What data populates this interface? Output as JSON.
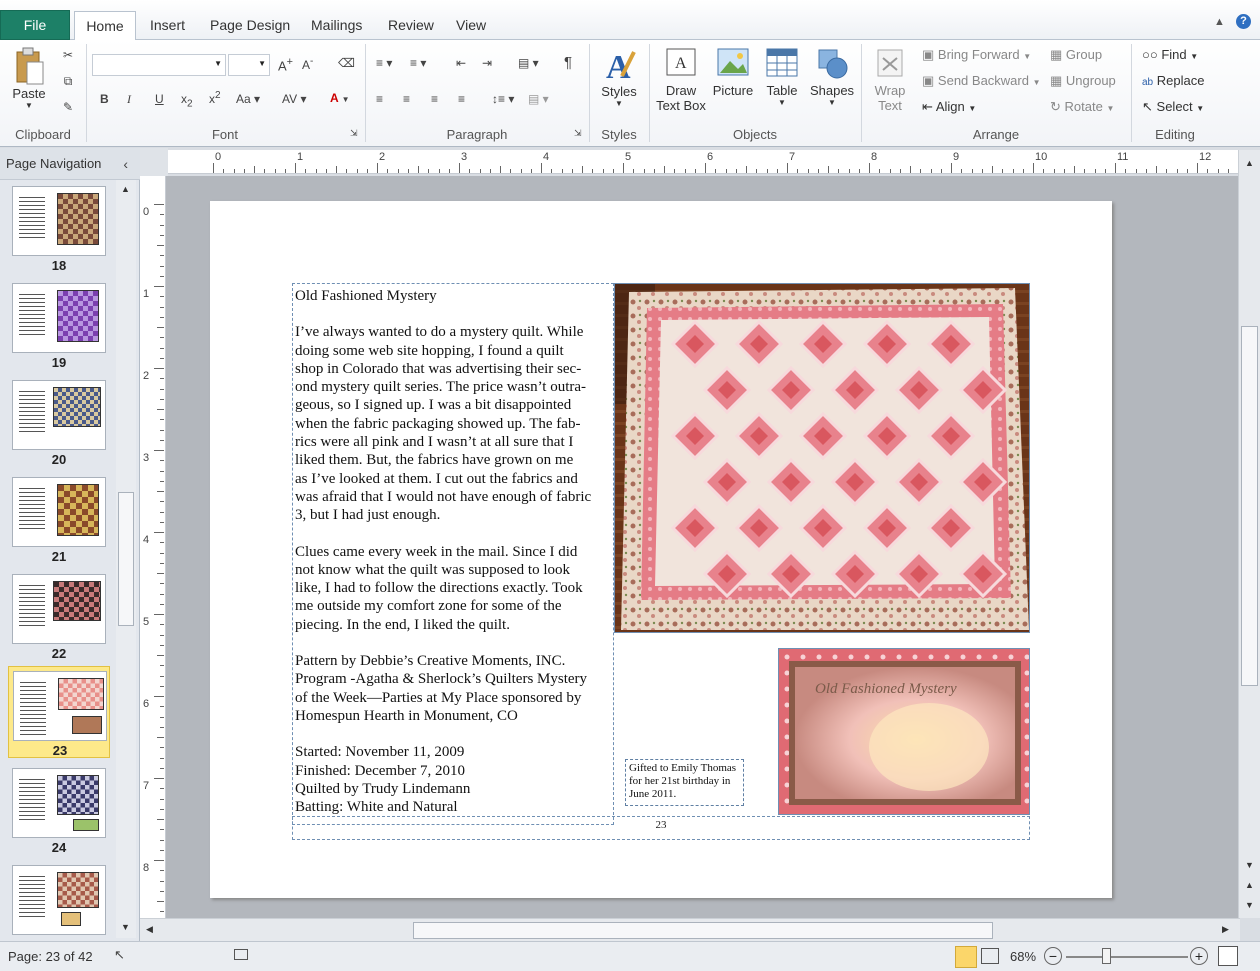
{
  "tabs": {
    "file": "File",
    "home": "Home",
    "insert": "Insert",
    "page_design": "Page Design",
    "mailings": "Mailings",
    "review": "Review",
    "view": "View"
  },
  "clipboard": {
    "paste": "Paste",
    "label": "Clipboard"
  },
  "font": {
    "label": "Font",
    "name_value": "",
    "size_value": ""
  },
  "paragraph": {
    "label": "Paragraph"
  },
  "styles": {
    "button": "Styles",
    "label": "Styles"
  },
  "objects": {
    "draw_text_box_1": "Draw",
    "draw_text_box_2": "Text Box",
    "picture": "Picture",
    "table": "Table",
    "shapes": "Shapes",
    "label": "Objects"
  },
  "arrange": {
    "wrap_text_1": "Wrap",
    "wrap_text_2": "Text",
    "bring_forward": "Bring Forward",
    "send_backward": "Send Backward",
    "align": "Align",
    "group": "Group",
    "ungroup": "Ungroup",
    "rotate": "Rotate",
    "label": "Arrange"
  },
  "editing": {
    "find": "Find",
    "replace": "Replace",
    "select": "Select",
    "label": "Editing"
  },
  "navigation": {
    "title": "Page Navigation",
    "pages": [
      "18",
      "19",
      "20",
      "21",
      "22",
      "23",
      "24",
      ""
    ],
    "selected": "23"
  },
  "ruler": {
    "h_ticks": [
      "0",
      "1",
      "2",
      "3",
      "4",
      "5",
      "6",
      "7",
      "8",
      "9",
      "10",
      "11",
      "12"
    ],
    "v_ticks": [
      "0",
      "1",
      "2",
      "3",
      "4",
      "5",
      "6",
      "7",
      "8"
    ]
  },
  "document": {
    "title": "Old Fashioned Mystery",
    "para1": "I’ve always wanted to do a mystery quilt.  While\ndoing some web site hopping, I found a quilt\nshop in Colorado that was advertising their sec-\nond mystery quilt series.  The price wasn’t outra-\ngeous, so I signed up.  I was a bit disappointed\nwhen the fabric packaging showed up.  The fab-\nrics were all pink and I wasn’t at all sure that I\nliked them.  But, the fabrics have grown on me\nas I’ve looked at them.  I cut out the fabrics and\nwas afraid that I would not have enough of fabric\n3, but I had just enough.",
    "para2": "Clues came every week in the mail.  Since I did\nnot know what the quilt was supposed to look\nlike, I had to follow the directions exactly.  Took\nme outside my comfort zone for some of the\npiecing.  In the end, I liked the quilt.",
    "para3": "Pattern by Debbie’s Creative Moments, INC.\nProgram  -Agatha & Sherlock’s Quilters Mystery\nof the Week—Parties at My Place  sponsored by\nHomespun Hearth in Monument, CO",
    "para4": "Started:  November 11, 2009\nFinished:  December 7, 2010\nQuilted by Trudy Lindemann\nBatting:  White and Natural",
    "gift_caption": "Gifted to Emily Thomas\nfor her 21st birthday in\nJune 2011.",
    "page_number": "23",
    "label_title": "Old Fashioned Mystery"
  },
  "status": {
    "page": "Page: 23 of 42",
    "zoom": "68%"
  }
}
